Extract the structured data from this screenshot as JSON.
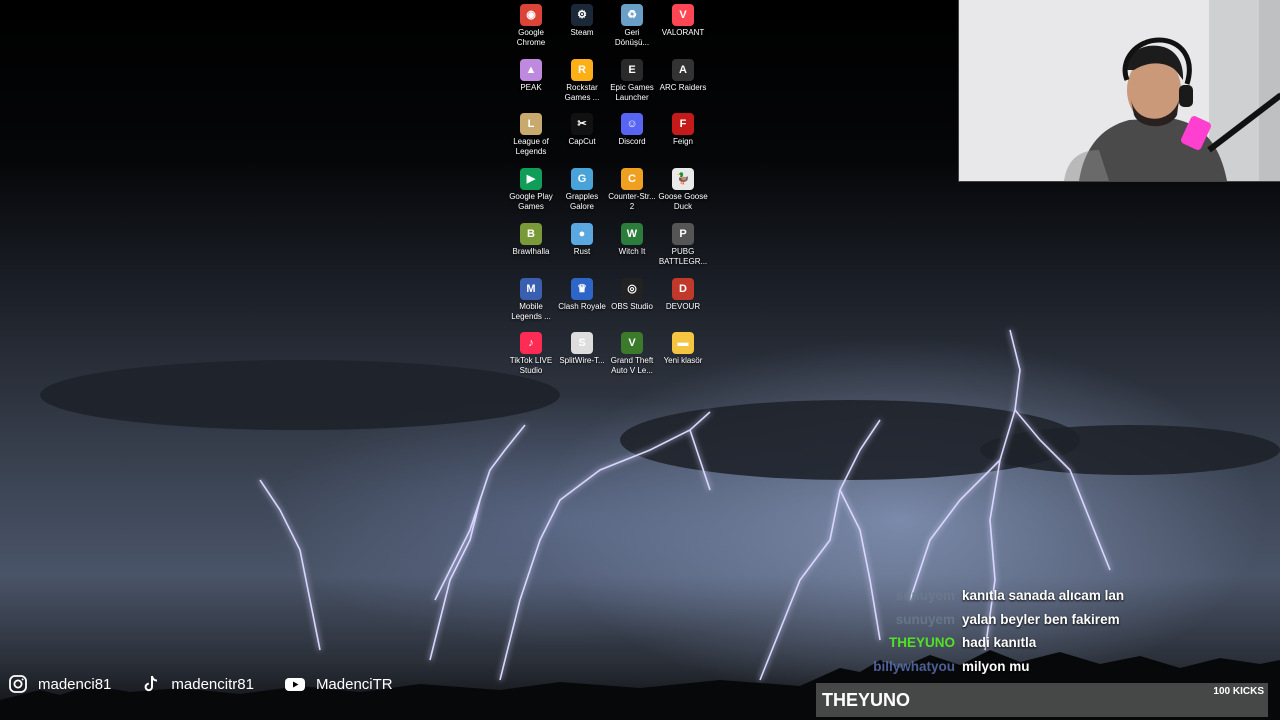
{
  "desktop": {
    "icons": [
      {
        "label": "Google Chrome",
        "icon": "chrome-icon",
        "color": "#db4437",
        "glyph": "◉"
      },
      {
        "label": "Steam",
        "icon": "steam-icon",
        "color": "#1b2838",
        "glyph": "⚙"
      },
      {
        "label": "Geri Dönüşü...",
        "icon": "recycle-bin-icon",
        "color": "#6aa0c8",
        "glyph": "♻"
      },
      {
        "label": "VALORANT",
        "icon": "valorant-icon",
        "color": "#ff4655",
        "glyph": "V"
      },
      {
        "label": "PEAK",
        "icon": "peak-icon",
        "color": "#c089e0",
        "glyph": "▲"
      },
      {
        "label": "Rockstar Games ...",
        "icon": "rockstar-icon",
        "color": "#fcaf17",
        "glyph": "R"
      },
      {
        "label": "Epic Games Launcher",
        "icon": "epic-games-icon",
        "color": "#2a2a2a",
        "glyph": "E"
      },
      {
        "label": "ARC Raiders",
        "icon": "arc-raiders-icon",
        "color": "#333",
        "glyph": "A"
      },
      {
        "label": "League of Legends",
        "icon": "league-icon",
        "color": "#c8aa6e",
        "glyph": "L"
      },
      {
        "label": "CapCut",
        "icon": "capcut-icon",
        "color": "#111",
        "glyph": "✂"
      },
      {
        "label": "Discord",
        "icon": "discord-icon",
        "color": "#5865f2",
        "glyph": "☺"
      },
      {
        "label": "Feign",
        "icon": "feign-icon",
        "color": "#c41a1a",
        "glyph": "F"
      },
      {
        "label": "Google Play Games",
        "icon": "google-play-games-icon",
        "color": "#0f9d58",
        "glyph": "▶"
      },
      {
        "label": "Grapples Galore",
        "icon": "grapples-galore-icon",
        "color": "#4aa3d8",
        "glyph": "G"
      },
      {
        "label": "Counter-Str... 2",
        "icon": "counter-strike-icon",
        "color": "#f0a020",
        "glyph": "C"
      },
      {
        "label": "Goose Goose Duck",
        "icon": "goose-goose-duck-icon",
        "color": "#e9e9e9",
        "glyph": "🦆"
      },
      {
        "label": "Brawlhalla",
        "icon": "brawlhalla-icon",
        "color": "#7a9a3a",
        "glyph": "B"
      },
      {
        "label": "Rust",
        "icon": "rust-icon",
        "color": "#5ba7e0",
        "glyph": "●"
      },
      {
        "label": "Witch It",
        "icon": "witch-it-icon",
        "color": "#2c7d3b",
        "glyph": "W"
      },
      {
        "label": "PUBG BATTLEGR...",
        "icon": "pubg-icon",
        "color": "#555",
        "glyph": "P"
      },
      {
        "label": "Mobile Legends ...",
        "icon": "mobile-legends-icon",
        "color": "#3a5fb0",
        "glyph": "M"
      },
      {
        "label": "Clash Royale",
        "icon": "clash-royale-icon",
        "color": "#2e66c7",
        "glyph": "♛"
      },
      {
        "label": "OBS Studio",
        "icon": "obs-studio-icon",
        "color": "#222",
        "glyph": "◎"
      },
      {
        "label": "DEVOUR",
        "icon": "devour-icon",
        "color": "#c0392b",
        "glyph": "D"
      },
      {
        "label": "TikTok LIVE Studio",
        "icon": "tiktok-live-icon",
        "color": "#fe2c55",
        "glyph": "♪"
      },
      {
        "label": "SplitWire-T...",
        "icon": "splitwire-icon",
        "color": "#ddd",
        "glyph": "S"
      },
      {
        "label": "Grand Theft Auto V Le...",
        "icon": "gta-v-icon",
        "color": "#3a7a2a",
        "glyph": "V"
      },
      {
        "label": "Yeni klasör",
        "icon": "folder-icon",
        "color": "#f5c542",
        "glyph": "▬"
      }
    ]
  },
  "socials": [
    {
      "platform": "instagram",
      "icon": "instagram-icon",
      "handle": "madenci81"
    },
    {
      "platform": "tiktok",
      "icon": "tiktok-icon",
      "handle": "madencitr81"
    },
    {
      "platform": "youtube",
      "icon": "youtube-icon",
      "handle": "MadenciTR"
    }
  ],
  "chat": {
    "messages": [
      {
        "user": "sunuyem",
        "color": "#6b7a8c",
        "text": "kanıtla sanada alıcam lan"
      },
      {
        "user": "sunuyem",
        "color": "#6b7a8c",
        "text": "yalan beyler ben fakirem"
      },
      {
        "user": "THEYUNO",
        "color": "#53fc18",
        "text": "hadi kanıtla"
      },
      {
        "user": "billywhatyou",
        "color": "#5a6fae",
        "text": "milyon mu"
      }
    ]
  },
  "kick_bar": {
    "name": "THEYUNO",
    "count": "100 KICKS"
  }
}
